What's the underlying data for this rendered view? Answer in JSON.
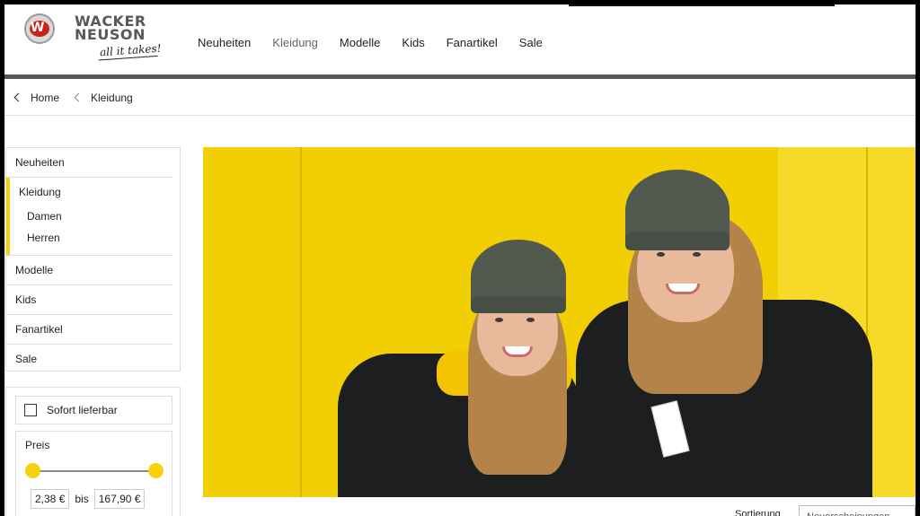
{
  "brand": {
    "name_line1": "WACKER",
    "name_line2": "NEUSON",
    "tagline": "all it takes!",
    "logo_mark": "W"
  },
  "nav": {
    "items": [
      {
        "label": "Neuheiten"
      },
      {
        "label": "Kleidung",
        "active": true
      },
      {
        "label": "Modelle"
      },
      {
        "label": "Kids"
      },
      {
        "label": "Fanartikel"
      },
      {
        "label": "Sale"
      }
    ]
  },
  "breadcrumb": {
    "items": [
      {
        "label": "Home"
      },
      {
        "label": "Kleidung"
      }
    ]
  },
  "sidebar": {
    "items": [
      {
        "label": "Neuheiten"
      },
      {
        "label": "Kleidung",
        "active": true,
        "children": [
          {
            "label": "Damen"
          },
          {
            "label": "Herren"
          }
        ]
      },
      {
        "label": "Modelle"
      },
      {
        "label": "Kids"
      },
      {
        "label": "Fanartikel"
      },
      {
        "label": "Sale"
      }
    ]
  },
  "filter": {
    "instock_label": "Sofort lieferbar",
    "instock_checked": false,
    "price_label": "Preis",
    "price_min": "2,38 €",
    "price_max": "167,90 €",
    "price_separator": "bis"
  },
  "hero": {
    "icon": "photo-two-women-in-beanies"
  },
  "sort": {
    "label": "Sortierung",
    "selected": "Neuerscheinungen"
  },
  "colors": {
    "accent": "#f5d20c",
    "header_bar": "#58585a",
    "hero_bg": "#f2cf05"
  }
}
